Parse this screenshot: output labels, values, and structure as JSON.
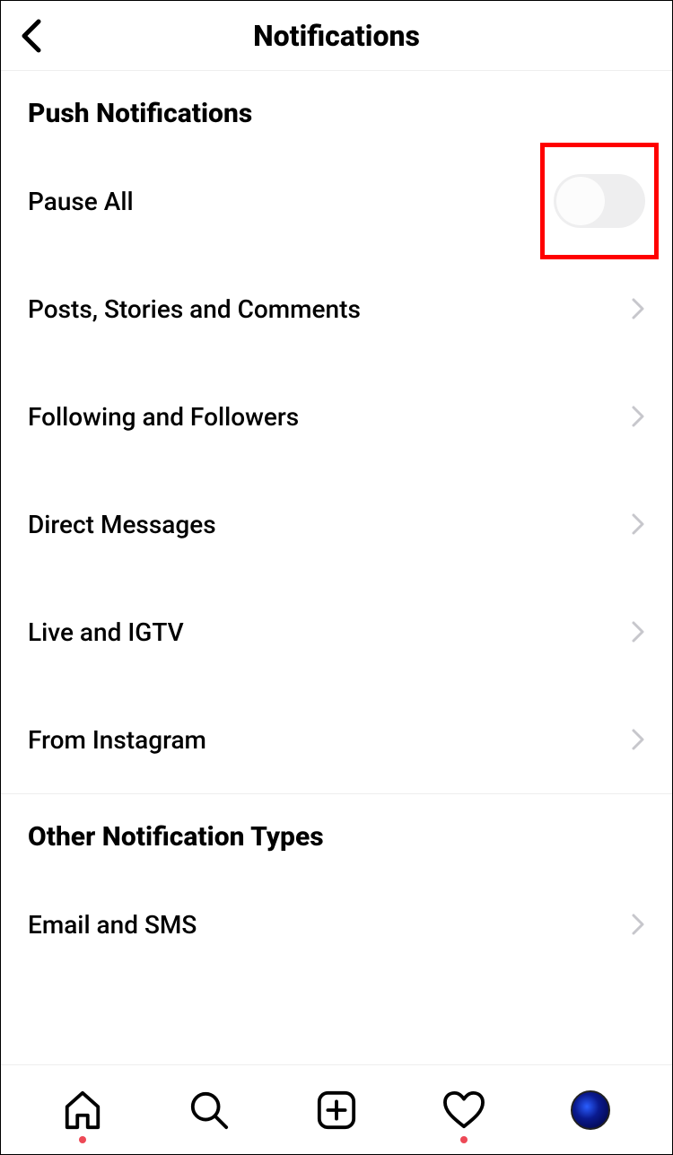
{
  "header": {
    "title": "Notifications"
  },
  "sections": {
    "push_header": "Push Notifications",
    "pause_all_label": "Pause All",
    "pause_all_on": false,
    "items": [
      "Posts, Stories and Comments",
      "Following and Followers",
      "Direct Messages",
      "Live and IGTV",
      "From Instagram"
    ],
    "other_header": "Other Notification Types",
    "other_item": "Email and SMS"
  }
}
